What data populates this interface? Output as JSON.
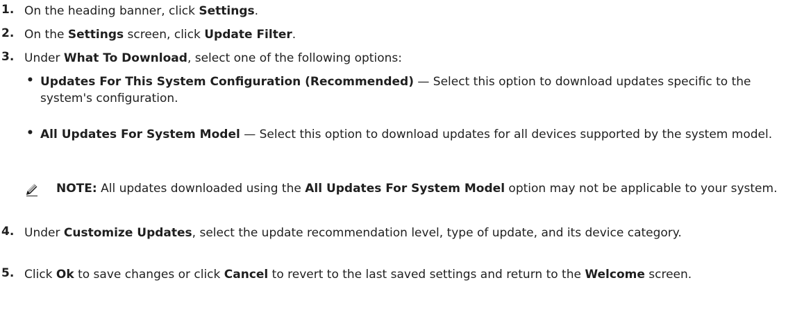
{
  "steps": [
    {
      "num": "1.",
      "p1": "On the heading banner, click ",
      "b1": "Settings",
      "p2": "."
    },
    {
      "num": "2.",
      "p1": "On the ",
      "b1": "Settings",
      "p2": " screen, click ",
      "b2": "Update Filter",
      "p3": "."
    },
    {
      "num": "3.",
      "p1": "Under ",
      "b1": "What To Download",
      "p2": ", select one of the following options:"
    },
    {
      "num": "4.",
      "p1": "Under ",
      "b1": "Customize Updates",
      "p2": ", select the update recommendation level, type of update, and its device category."
    },
    {
      "num": "5.",
      "p1": "Click ",
      "b1": "Ok",
      "p2": " to save changes or click ",
      "b2": "Cancel",
      "p3": " to revert to the last saved settings and return to the ",
      "b3": "Welcome",
      "p4": " screen."
    }
  ],
  "options": [
    {
      "bullet": "•",
      "title": "Updates For This System Configuration (Recommended)",
      "desc": " — Select this option to download updates specific to the system's configuration."
    },
    {
      "bullet": "•",
      "title": "All Updates For System Model",
      "desc": " — Select this option to download updates for all devices supported by the system model."
    }
  ],
  "note": {
    "icon": "pencil-note-icon",
    "label": "NOTE:",
    "p1": " All updates downloaded using the ",
    "b1": "All Updates For System Model",
    "p2": " option may not be applicable to your system."
  }
}
